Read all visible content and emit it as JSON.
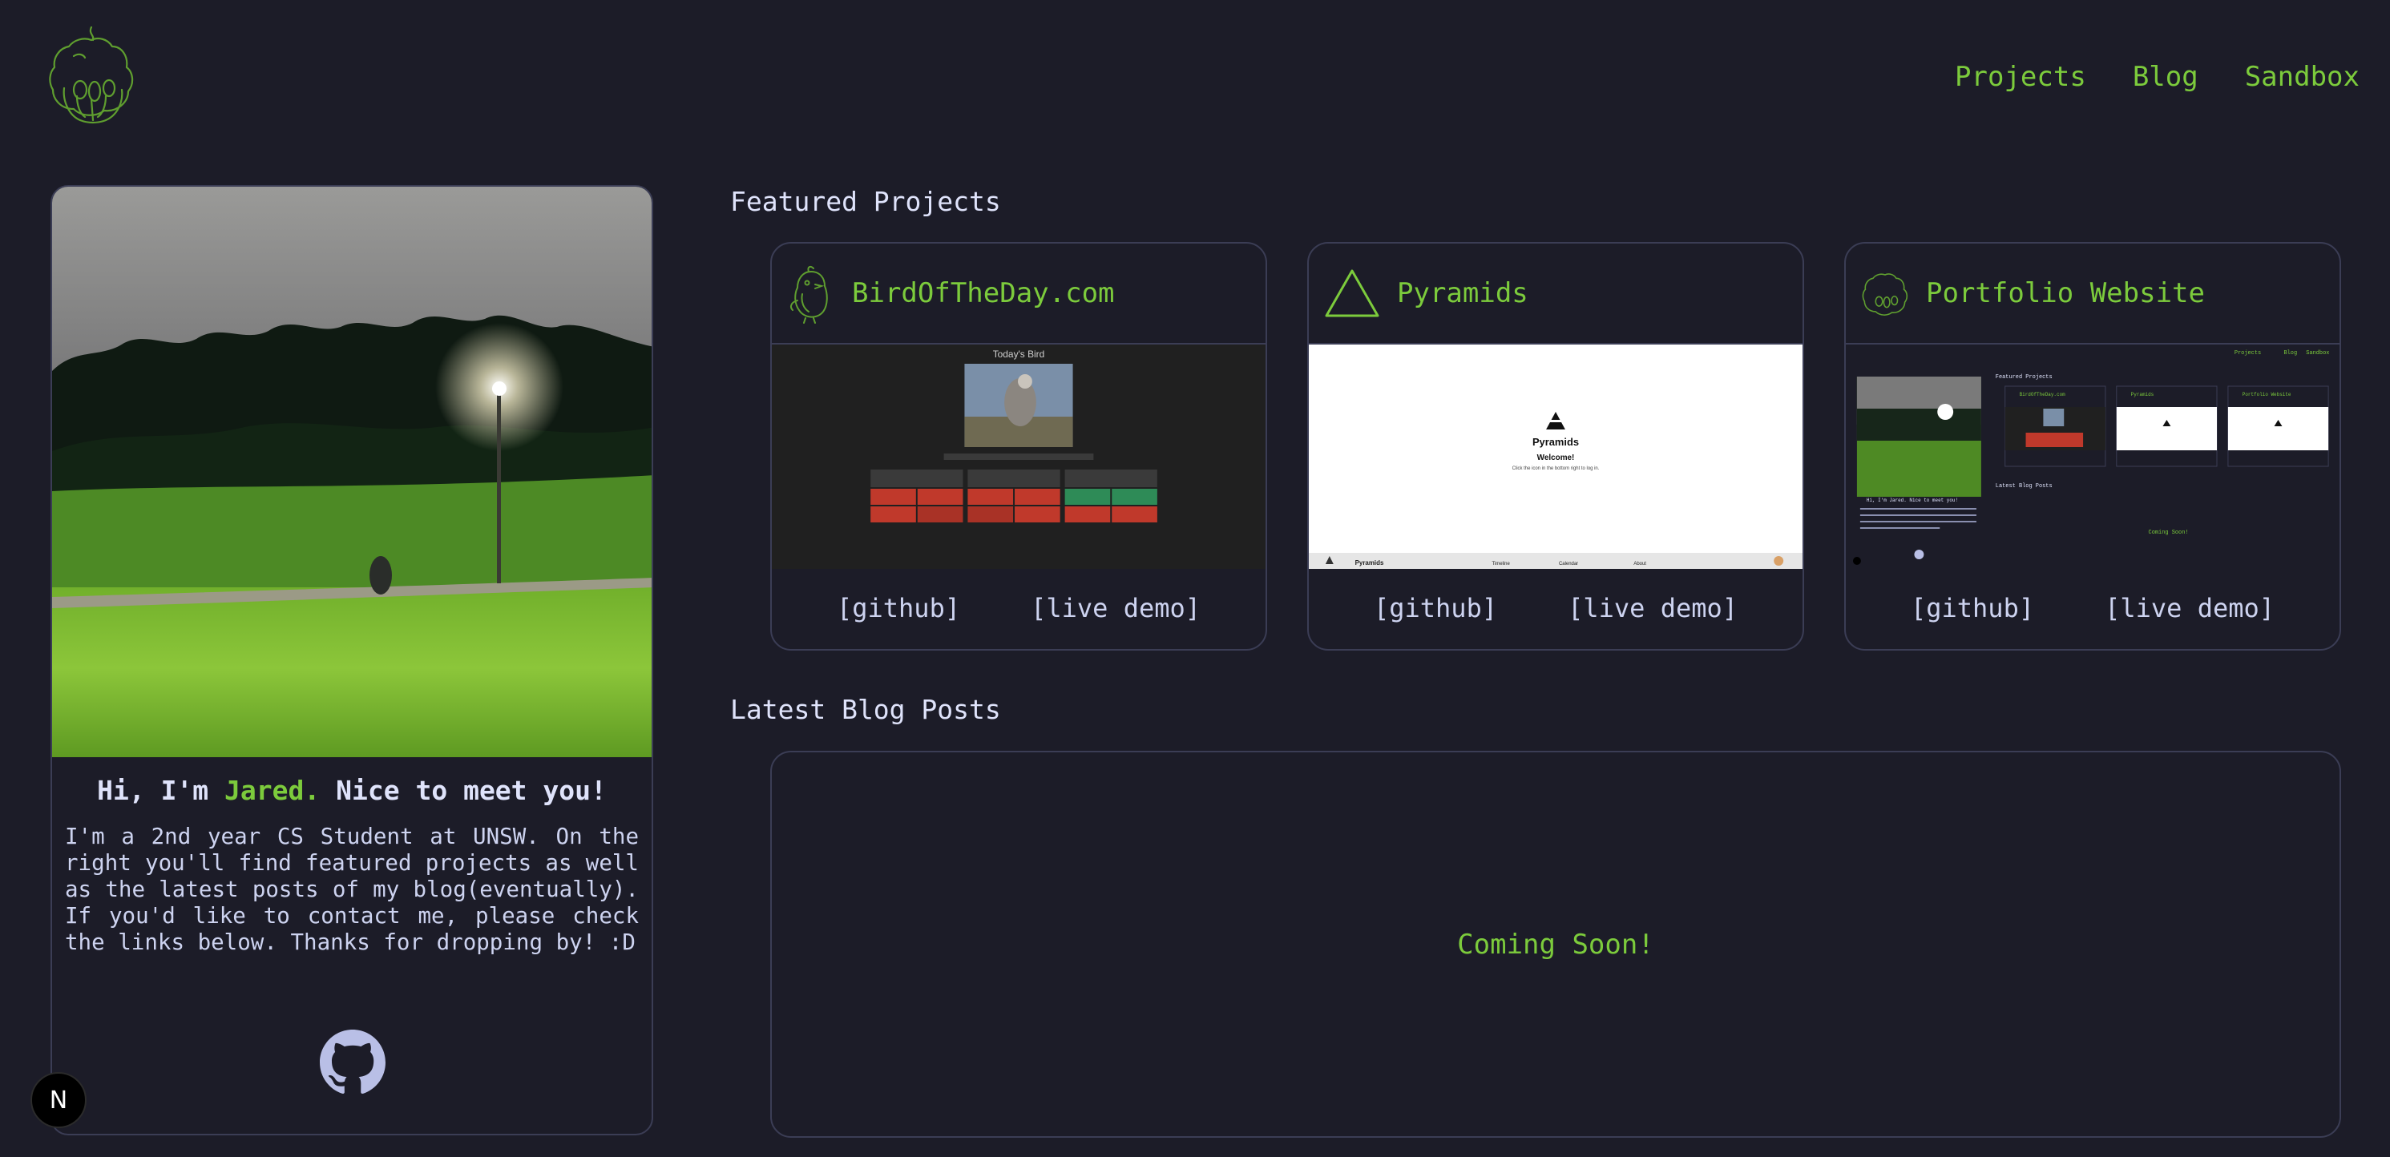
{
  "nav": {
    "projects": "Projects",
    "blog": "Blog",
    "sandbox": "Sandbox"
  },
  "profile": {
    "greeting_prefix": "Hi, I'm ",
    "name": "Jared.",
    "greeting_suffix": " Nice to meet you!",
    "bio": "I'm a 2nd year CS Student at UNSW. On the right you'll find featured projects as well as the latest posts of my blog(eventually). If you'd like to contact me, please check the links below. Thanks for dropping by! :D"
  },
  "featured": {
    "title": "Featured Projects",
    "projects": [
      {
        "title": "BirdOfTheDay.com",
        "github": "[github]",
        "demo": "[live demo]",
        "icon": "bird-icon",
        "preview": {
          "heading": "Today's Bird"
        }
      },
      {
        "title": "Pyramids",
        "github": "[github]",
        "demo": "[live demo]",
        "icon": "triangle-icon",
        "preview": {
          "app": "Pyramids",
          "welcome": "Welcome!",
          "hint": "Click the icon in the bottom right to log in.",
          "nav": [
            "Pyramids",
            "Timeline",
            "Calendar",
            "About"
          ]
        }
      },
      {
        "title": "Portfolio Website",
        "github": "[github]",
        "demo": "[live demo]",
        "icon": "cupcake-icon",
        "preview": {
          "nav": [
            "Projects",
            "Blog",
            "Sandbox"
          ],
          "featured": "Featured Projects",
          "cards": [
            "BirdOfTheDay.com",
            "Pyramids",
            "Portfolio Website"
          ],
          "blog": "Latest Blog Posts",
          "soon": "Coming Soon!",
          "hi": "Hi, I'm Jared. Nice to meet you!"
        }
      }
    ]
  },
  "blog": {
    "title": "Latest Blog Posts",
    "placeholder": "Coming Soon!"
  },
  "badge": {
    "letter": "N"
  },
  "colors": {
    "accent": "#7ccb3c",
    "background": "#1c1c28",
    "border": "#3b3d55",
    "text": "#cdd3f0"
  }
}
